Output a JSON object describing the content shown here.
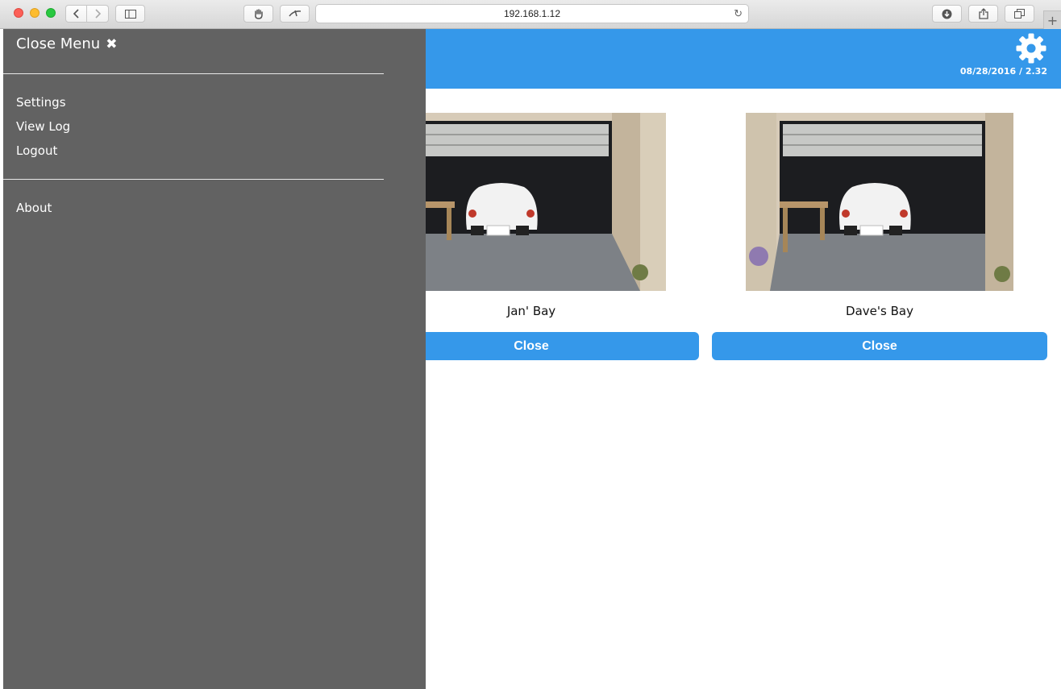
{
  "browser": {
    "url": "192.168.1.12"
  },
  "header": {
    "date_version": "08/28/2016 / 2.32"
  },
  "bays": [
    {
      "name": "Jan' Bay",
      "button_label": "Close"
    },
    {
      "name": "Dave's Bay",
      "button_label": "Close"
    }
  ],
  "menu": {
    "close_label": "Close Menu",
    "close_icon": "✖",
    "items": [
      {
        "label": "Settings"
      },
      {
        "label": "View Log"
      },
      {
        "label": "Logout"
      }
    ],
    "secondary_items": [
      {
        "label": "About"
      }
    ]
  },
  "colors": {
    "accent": "#3598ea",
    "drawer": "#626262"
  }
}
